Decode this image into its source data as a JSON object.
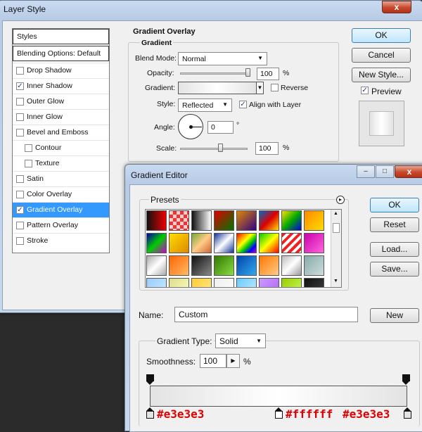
{
  "layer_style": {
    "title": "Layer Style",
    "close_glyph": "x",
    "styles_header": "Styles",
    "blending_header": "Blending Options: Default",
    "items": [
      {
        "label": "Drop Shadow",
        "checked": false
      },
      {
        "label": "Inner Shadow",
        "checked": true
      },
      {
        "label": "Outer Glow",
        "checked": false
      },
      {
        "label": "Inner Glow",
        "checked": false
      },
      {
        "label": "Bevel and Emboss",
        "checked": false
      },
      {
        "label": "Contour",
        "checked": false
      },
      {
        "label": "Texture",
        "checked": false
      },
      {
        "label": "Satin",
        "checked": false
      },
      {
        "label": "Color Overlay",
        "checked": false
      },
      {
        "label": "Gradient Overlay",
        "checked": true
      },
      {
        "label": "Pattern Overlay",
        "checked": false
      },
      {
        "label": "Stroke",
        "checked": false
      }
    ],
    "panel": {
      "section_title": "Gradient Overlay",
      "group_title": "Gradient",
      "blend_mode_label": "Blend Mode:",
      "blend_mode_value": "Normal",
      "opacity_label": "Opacity:",
      "opacity_value": "100",
      "opacity_unit": "%",
      "opacity_fraction": 1.0,
      "gradient_label": "Gradient:",
      "reverse_label": "Reverse",
      "reverse_checked": false,
      "style_label": "Style:",
      "style_value": "Reflected",
      "align_label": "Align with Layer",
      "align_checked": true,
      "angle_label": "Angle:",
      "angle_value": "0",
      "angle_unit": "°",
      "scale_label": "Scale:",
      "scale_value": "100",
      "scale_unit": "%",
      "scale_fraction": 0.6
    },
    "buttons": {
      "ok": "OK",
      "cancel": "Cancel",
      "new_style": "New Style..."
    },
    "preview_label": "Preview",
    "preview_checked": true
  },
  "gradient_editor": {
    "title": "Gradient Editor",
    "minimize_glyph": "–",
    "maximize_glyph": "□",
    "close_glyph": "x",
    "presets_label": "Presets",
    "presets_menu_glyph": "▸",
    "buttons": {
      "ok": "OK",
      "reset": "Reset",
      "load": "Load...",
      "save": "Save..."
    },
    "name_label": "Name:",
    "name_value": "Custom",
    "new_button": "New",
    "gradient_type_label": "Gradient Type:",
    "gradient_type_value": "Solid",
    "smoothness_label": "Smoothness:",
    "smoothness_value": "100",
    "smoothness_unit": "%",
    "stops": [
      {
        "color": "#e3e3e3",
        "position": 0.0,
        "label": "#e3e3e3"
      },
      {
        "color": "#ffffff",
        "position": 0.5,
        "label": "#ffffff"
      },
      {
        "color": "#e3e3e3",
        "position": 1.0,
        "label": "#e3e3e3"
      }
    ],
    "annotation_color": "#dd0000"
  },
  "colors": {
    "selection_blue": "#3399ff",
    "title_bar": "#c9daf0",
    "dialog_bg": "#f0f0f0"
  }
}
